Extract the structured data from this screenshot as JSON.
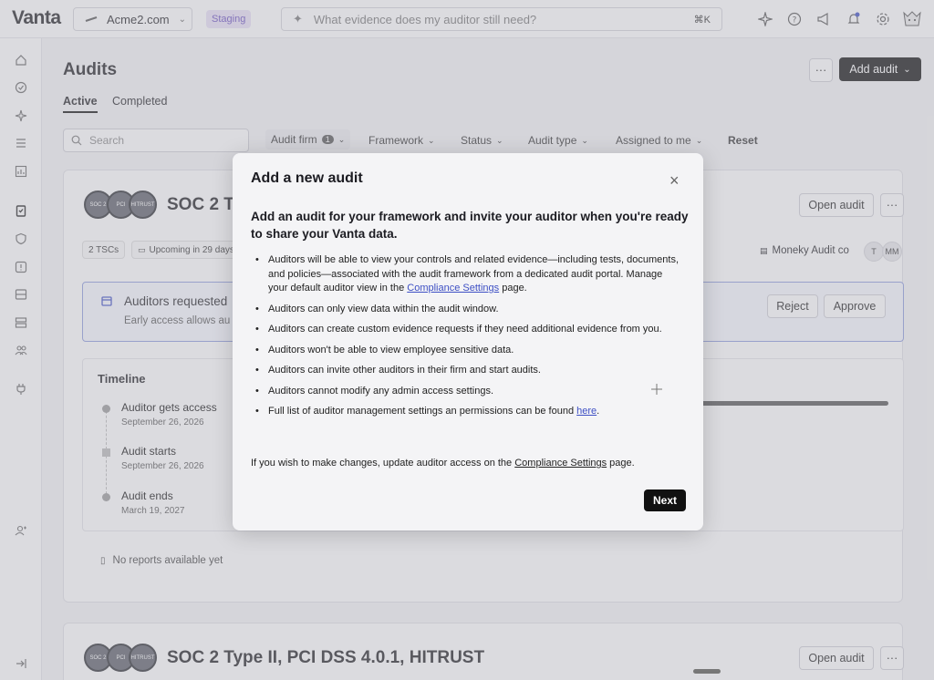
{
  "brand": "Vanta",
  "org": {
    "name": "Acme2.com",
    "env_badge": "Staging"
  },
  "ask": {
    "placeholder": "What evidence does my auditor still need?",
    "shortcut": "⌘K"
  },
  "topbar_icons": [
    "sparkle-icon",
    "help-icon",
    "megaphone-icon",
    "bell-icon",
    "gear-icon",
    "user-avatar"
  ],
  "sidebar_icons": [
    "home-icon",
    "check-circle-icon",
    "sparkle-icon",
    "list-icon",
    "chart-icon",
    "clipboard-icon",
    "shield-icon",
    "alert-icon",
    "inbox-icon",
    "server-icon",
    "people-icon",
    "plug-icon",
    "user-manage-icon",
    "collapse-icon"
  ],
  "page": {
    "title": "Audits",
    "more_label": "···",
    "add_audit_label": "Add audit",
    "tabs": [
      {
        "label": "Active"
      },
      {
        "label": "Completed"
      }
    ]
  },
  "filters": {
    "search_placeholder": "Search",
    "audit_firm": "Audit firm",
    "audit_firm_count": "1",
    "framework": "Framework",
    "status": "Status",
    "audit_type": "Audit type",
    "assigned_to_me": "Assigned to me",
    "reset": "Reset"
  },
  "card1": {
    "title": "SOC 2 Type II, PCI DSS 4.0.1, HITRUST",
    "title_visible": "SOC 2 T",
    "open_label": "Open audit",
    "more_label": "···",
    "tscs": "2 TSCs",
    "upcoming": "Upcoming in 29 days",
    "auditor_firm": "Moneky Audit co",
    "avatars": [
      "T",
      "MM"
    ],
    "request_title": "Auditors requested early access",
    "request_title_visible": "Auditors requested",
    "request_desc_visible": "Early access allows au",
    "reject_label": "Reject",
    "approve_label": "Approve",
    "timeline_heading": "Timeline",
    "timeline": [
      {
        "title": "Auditor gets access",
        "date": "September 26, 2026"
      },
      {
        "title": "Audit starts",
        "date": "September 26, 2026"
      },
      {
        "title": "Audit ends",
        "date": "March 19, 2027"
      }
    ],
    "reports": "No reports available yet"
  },
  "card2": {
    "title": "SOC 2 Type II, PCI DSS 4.0.1, HITRUST",
    "open_label": "Open audit",
    "more_label": "···"
  },
  "seals": [
    "SOC 2",
    "PCI",
    "HITRUST"
  ],
  "modal": {
    "title": "Add a new audit",
    "close": "×",
    "lead": "Add an audit for your framework and invite your auditor when you're ready to share your Vanta data.",
    "b1_pre": "Auditors will be able to view your controls and related evidence—including tests, documents, and policies—associated with the audit framework from a dedicated audit portal. Manage your default auditor view in the ",
    "b1_link": "Compliance Settings",
    "b1_post": " page.",
    "b2": "Auditors can only view data within the audit window.",
    "b3": "Auditors can create custom evidence requests if they need additional evidence from you.",
    "b4": "Auditors won't be able to view employee sensitive data.",
    "b5": "Auditors can invite other auditors in their firm and start audits.",
    "b6": "Auditors cannot modify any admin access settings.",
    "b7_pre": "Full list of auditor management settings an permissions can be found ",
    "b7_link": "here",
    "b7_post": ".",
    "foot_pre": "If you wish to make changes, update auditor access on the ",
    "foot_link": "Compliance Settings",
    "foot_post": " page.",
    "next_label": "Next"
  }
}
